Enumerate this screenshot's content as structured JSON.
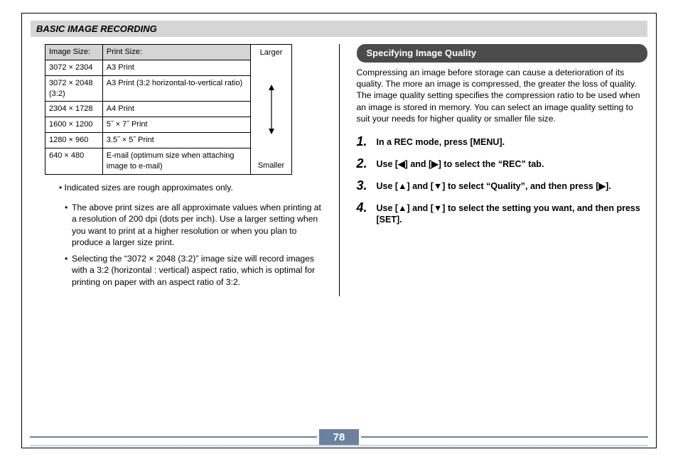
{
  "header": "BASIC IMAGE RECORDING",
  "table": {
    "headers": {
      "c1": "Image Size:",
      "c2": "Print Size:"
    },
    "rows": [
      {
        "size": "3072 × 2304",
        "print": "A3 Print"
      },
      {
        "size": "3072 × 2048 (3:2)",
        "print": "A3 Print (3:2 horizontal-to-vertical ratio)"
      },
      {
        "size": "2304 × 1728",
        "print": "A4 Print"
      },
      {
        "size": "1600 × 1200",
        "print": "5˝ × 7˝ Print"
      },
      {
        "size": "1280 × 960",
        "print": "3.5˝ × 5˝ Print"
      },
      {
        "size": "640 × 480",
        "print": "E-mail (optimum size when attaching image to e-mail)"
      }
    ],
    "range_top": "Larger",
    "range_bottom": "Smaller"
  },
  "note_indented": "• Indicated sizes are rough approximates only.",
  "left_bullets": [
    "The above print sizes are all approximate values when printing at a resolution of 200 dpi (dots per inch). Use a larger setting when you want to print at a higher resolution or when you plan to produce a larger size print.",
    "Selecting the “3072 × 2048 (3:2)” image size will record images with a 3:2 (horizontal : vertical) aspect ratio, which is optimal for printing on paper with an aspect ratio of 3:2."
  ],
  "right": {
    "section_title": "Specifying Image Quality",
    "intro": "Compressing an image before storage can cause a deterioration of its quality. The more an image is compressed, the greater the loss of quality. The image quality setting specifies the compression ratio to be used when an image is stored in memory. You can select an image quality setting to suit your needs for higher quality or smaller file size.",
    "steps": [
      "In a REC mode, press [MENU].",
      "Use [◀] and [▶] to select the “REC” tab.",
      "Use [▲] and [▼] to select “Quality”, and then press [▶].",
      "Use [▲] and [▼] to select the setting you want, and then press [SET]."
    ]
  },
  "page_number": "78"
}
